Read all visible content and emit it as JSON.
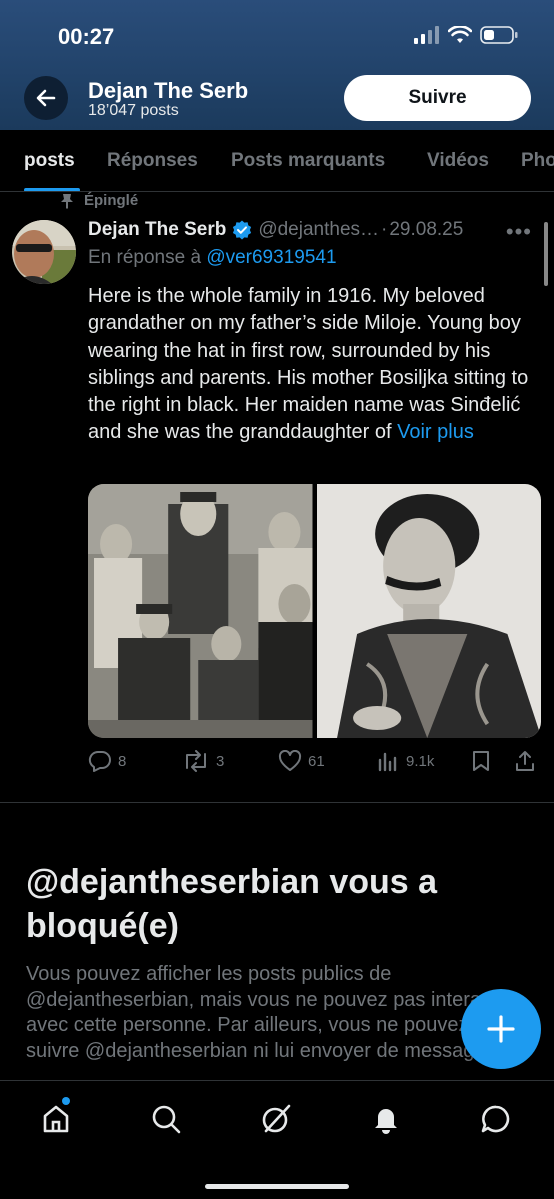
{
  "status_bar": {
    "time": "00:27"
  },
  "header": {
    "name": "Dejan The Serb",
    "post_count": "18’047 posts",
    "follow_label": "Suivre"
  },
  "tabs": [
    {
      "label": "posts",
      "active": true
    },
    {
      "label": "Réponses",
      "active": false
    },
    {
      "label": "Posts marquants",
      "active": false
    },
    {
      "label": "Vidéos",
      "active": false
    },
    {
      "label": "Pho",
      "active": false
    }
  ],
  "post": {
    "pinned_label": "Épinglé",
    "author_name": "Dejan The Serb",
    "author_handle": "@dejanthes…",
    "separator": "·",
    "date": "29.08.25",
    "reply_prefix": "En réponse à",
    "reply_to": "@ver69319541",
    "text": "Here is the whole family in 1916. My beloved grandather on my father’s side Miloje. Young boy wearing the hat in first row, surrounded by his siblings and parents. His mother Bosiljka sitting to the right in black. Her maiden name was Sinđelić and she was the granddaughter of",
    "see_more": "Voir plus",
    "stats": {
      "replies": "8",
      "reposts": "3",
      "likes": "61",
      "views": "9.1k"
    }
  },
  "blocked": {
    "title": "@dejantheserbian vous a bloqué(e)",
    "body": "Vous pouvez afficher les posts publics de @dejantheserbian, mais vous ne pouvez pas interagir avec cette personne. Par ailleurs, vous ne pouvez pas suivre @dejantheserbian ni lui envoyer de messages."
  },
  "colors": {
    "accent": "#1d9bf0",
    "background": "#000000",
    "muted": "#71767b",
    "header": "#24466f"
  },
  "icons": [
    "back-arrow-icon",
    "signal-icon",
    "wifi-icon",
    "battery-icon",
    "pin-icon",
    "verified-icon",
    "more-icon",
    "reply-icon",
    "repost-icon",
    "like-icon",
    "views-icon",
    "bookmark-icon",
    "share-icon",
    "compose-plus-icon",
    "home-icon",
    "search-icon",
    "grok-icon",
    "notifications-icon",
    "messages-icon"
  ]
}
